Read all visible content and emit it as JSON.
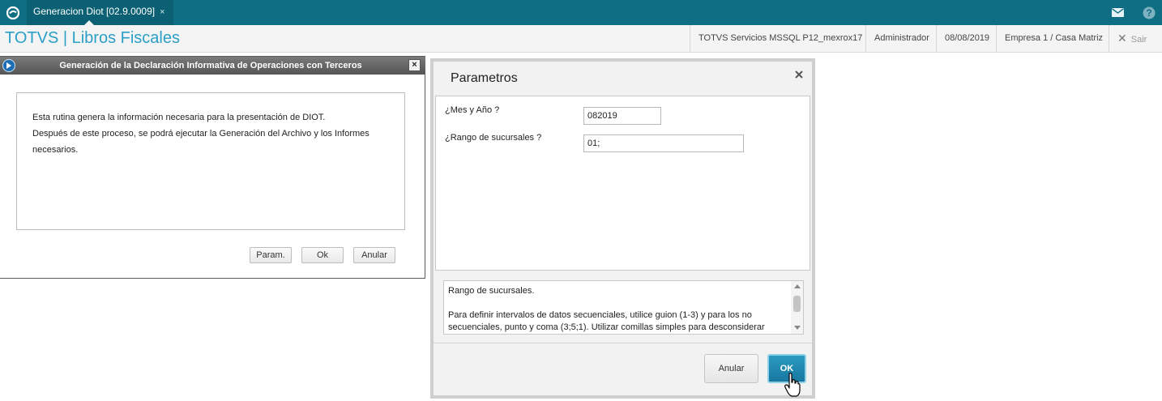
{
  "topbar": {
    "tab_label": "Generacion Diot [02.9.0009]",
    "tab_close": "×",
    "mail_icon": "mail-icon",
    "help_icon": "help-icon"
  },
  "appbar": {
    "title": "TOTVS | Libros Fiscales",
    "server": "TOTVS Servicios MSSQL P12_mexrox17",
    "user": "Administrador",
    "date": "08/08/2019",
    "company": "Empresa 1 / Casa Matriz",
    "logout": "Sair"
  },
  "diot_dialog": {
    "title": "Generación de la Declaración Informativa de Operaciones con Terceros",
    "close": "×",
    "line1": "Esta rutina genera la información necesaria para la presentación de  DIOT.",
    "line2": "Después de este proceso, se podrá ejecutar la Generación del Archivo y los Informes",
    "line3": "necesarios.",
    "btn_param": "Param.",
    "btn_ok": "Ok",
    "btn_anular": "Anular"
  },
  "params_dialog": {
    "title": "Parametros",
    "fields": [
      {
        "label": "¿Mes y Año ?",
        "value": "082019"
      },
      {
        "label": "¿Rango de sucursales ?",
        "value": "01;"
      }
    ],
    "help_title": "Rango de sucursales.",
    "help_body": "Para definir intervalos de datos secuenciales, utilice guion (1-3) y para los no secuenciales, punto y coma (3;5;1). Utilizar comillas simples para desconsiderar",
    "btn_anular": "Anular",
    "btn_ok": "OK"
  },
  "colors": {
    "topbar": "#0f6e84",
    "accent": "#2b9fc6",
    "ok_button": "#1f87ad"
  }
}
